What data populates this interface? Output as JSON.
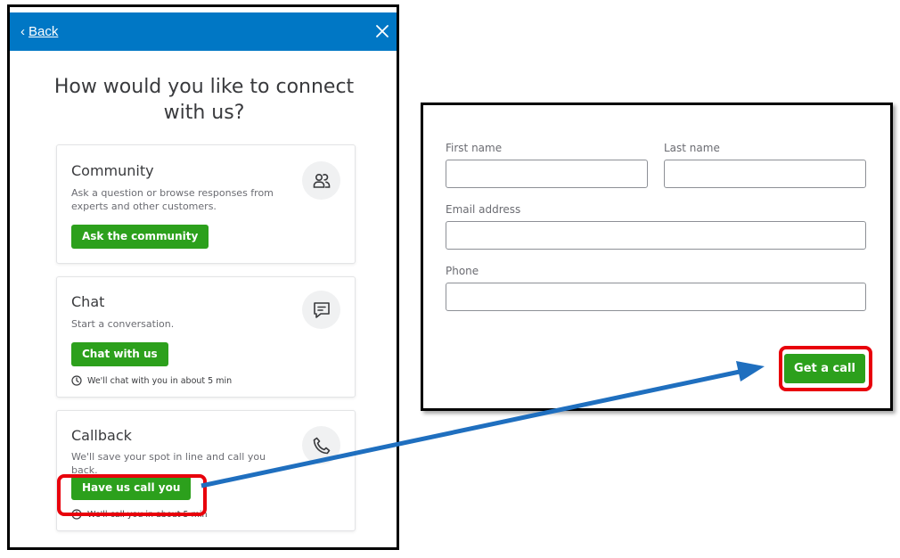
{
  "left_panel": {
    "header": {
      "back_label": "Back",
      "back_chevron": "‹",
      "close_icon": "close-icon"
    },
    "title": "How would you like to connect with us?",
    "cards": [
      {
        "title": "Community",
        "description": "Ask a question or browse responses from experts and other customers.",
        "button": "Ask the community",
        "icon": "people-icon"
      },
      {
        "title": "Chat",
        "description": "Start a conversation.",
        "button": "Chat with us",
        "wait": "We'll chat with you in about 5 min",
        "icon": "chat-bubble-icon"
      },
      {
        "title": "Callback",
        "description": "We'll save your spot in line and call you back.",
        "button": "Have us call you",
        "wait": "We'll call you in about 5 min",
        "icon": "phone-icon"
      }
    ]
  },
  "right_panel": {
    "fields": {
      "first_name": {
        "label": "First name",
        "value": ""
      },
      "last_name": {
        "label": "Last name",
        "value": ""
      },
      "email": {
        "label": "Email address",
        "value": ""
      },
      "phone": {
        "label": "Phone",
        "value": ""
      }
    },
    "button": "Get a call"
  },
  "colors": {
    "header_blue": "#0077c5",
    "button_green": "#2ca01c",
    "highlight_red": "#e8000b",
    "arrow_blue": "#1f6fbf"
  }
}
